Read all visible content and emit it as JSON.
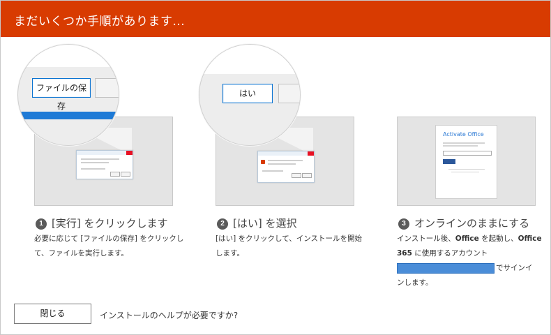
{
  "header": {
    "title": "まだいくつか手順があります..."
  },
  "steps": [
    {
      "number": "1",
      "title": "[実行] をクリックします",
      "desc_line1": "必要に応じて [ファイルの保存] をクリックし",
      "desc_line2": "て、ファイルを実行します。",
      "zoom_button": "ファイルの保存"
    },
    {
      "number": "2",
      "title": "[はい] を選択",
      "desc_line1": "[はい] をクリックして、インストールを開始",
      "desc_line2": "します。",
      "zoom_button": "はい"
    },
    {
      "number": "3",
      "title": "オンラインのままにする",
      "desc_line1_a": "インストール後、",
      "desc_line1_b": "Office",
      "desc_line1_c": " を起動し、",
      "desc_line1_d": "Office",
      "desc_line2_a": "365",
      "desc_line2_b": " に使用するアカウント",
      "desc_line3": "でサインイ",
      "desc_line4": "ンします。",
      "panel_title": "Activate Office"
    }
  ],
  "footer": {
    "close_label": "閉じる",
    "help_text": "インストールのヘルプが必要ですか?"
  },
  "colors": {
    "header": "#d83b01",
    "accent_blue": "#1e7ad6"
  }
}
